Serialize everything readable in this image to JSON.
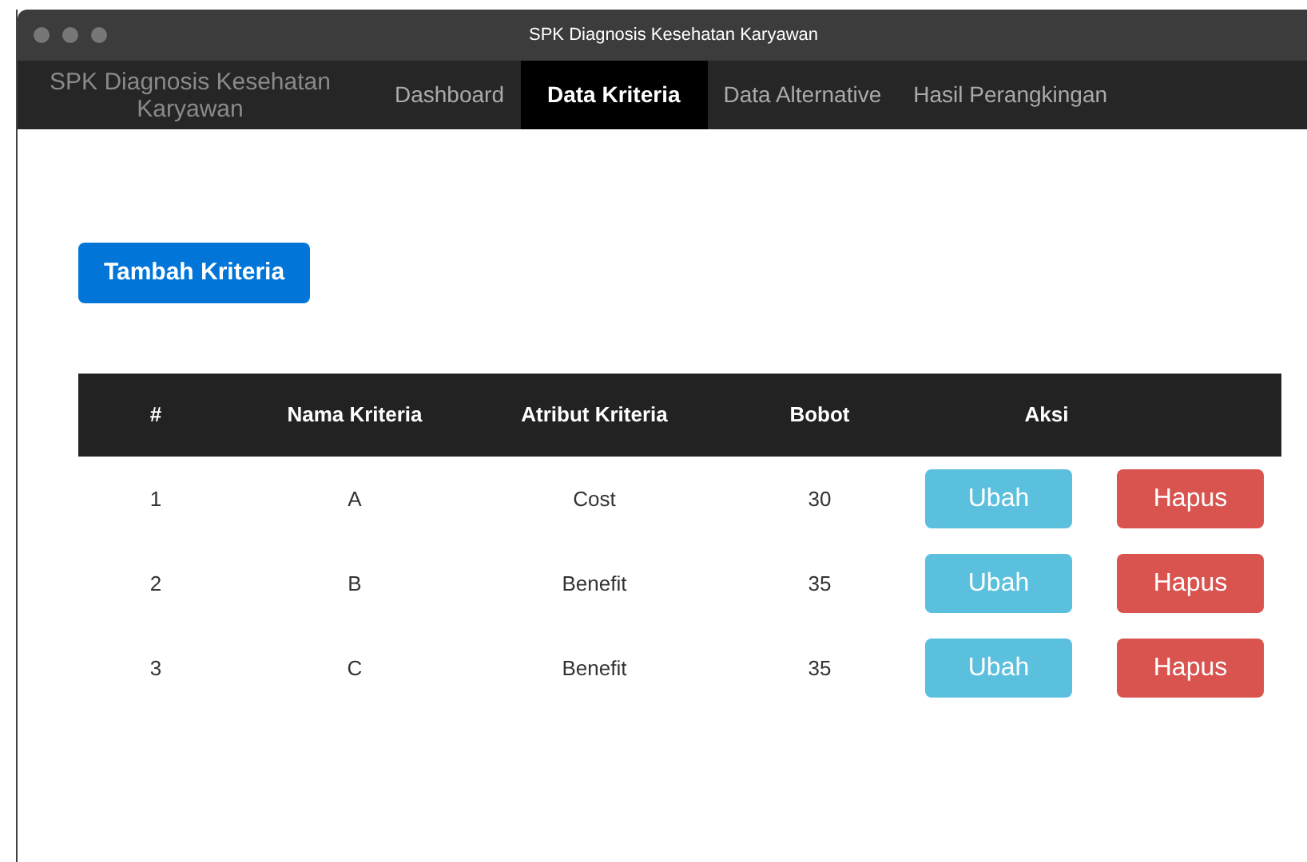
{
  "window": {
    "title": "SPK Diagnosis Kesehatan Karyawan"
  },
  "nav": {
    "brand": "SPK Diagnosis Kesehatan Karyawan",
    "tabs": [
      {
        "label": "Dashboard",
        "selected": false
      },
      {
        "label": "Data Kriteria",
        "selected": true
      },
      {
        "label": "Data Alternative",
        "selected": false
      },
      {
        "label": "Hasil Perangkingan",
        "selected": false
      }
    ]
  },
  "add_button": "Tambah Kriteria",
  "table": {
    "columns": [
      "#",
      "Nama Kriteria",
      "Atribut Kriteria",
      "Bobot",
      "Aksi"
    ],
    "rows": [
      {
        "cells": [
          "1",
          "A",
          "Cost",
          "30"
        ],
        "actions": [
          "Ubah",
          "Hapus"
        ]
      },
      {
        "cells": [
          "2",
          "B",
          "Benefit",
          "35"
        ],
        "actions": [
          "Ubah",
          "Hapus"
        ]
      },
      {
        "cells": [
          "3",
          "C",
          "Benefit",
          "35"
        ],
        "actions": [
          "Ubah",
          "Hapus"
        ]
      }
    ]
  }
}
